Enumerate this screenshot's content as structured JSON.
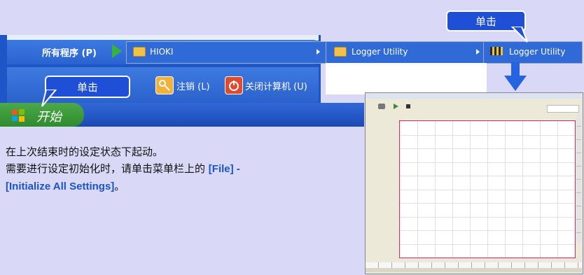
{
  "start_menu": {
    "all_programs": "所有程序 (P)",
    "logoff": "注销 (L)",
    "shutdown": "关闭计算机 (U)",
    "start": "开始"
  },
  "cascade": {
    "hioki": "HIOKI",
    "logger_folder": "Logger Utility",
    "logger_app": "Logger Utility"
  },
  "callouts": {
    "top": "单击",
    "bottom": "单击"
  },
  "description": {
    "line1": "在上次结束时的设定状态下起动。",
    "line2": "需要进行设定初始化时，请单击菜单栏上的 ",
    "file_menu": "[File] -",
    "line3_menu": "[Initialize All Settings]",
    "line3_end": "。"
  },
  "colors": {
    "accent": "#1e4fd6",
    "highlight": "#1b53c8",
    "background": "#d9d9f7"
  }
}
